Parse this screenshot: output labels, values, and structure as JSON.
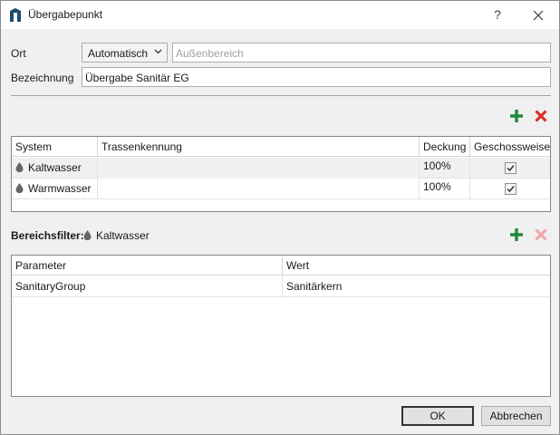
{
  "window": {
    "title": "Übergabepunkt",
    "help": "?"
  },
  "form": {
    "ort_label": "Ort",
    "ort_mode": "Automatisch",
    "ort_placeholder": "Außenbereich",
    "bezeichnung_label": "Bezeichnung",
    "bezeichnung_value": "Übergabe Sanitär EG"
  },
  "systems_grid": {
    "columns": [
      "System",
      "Trassenkennung",
      "Deckung",
      "Geschossweise"
    ],
    "rows": [
      {
        "system": "Kaltwasser",
        "trasse": "",
        "deckung": "100%",
        "geschossweise": true,
        "selected": true
      },
      {
        "system": "Warmwasser",
        "trasse": "",
        "deckung": "100%",
        "geschossweise": true,
        "selected": false
      }
    ]
  },
  "filter": {
    "label": "Bereichsfilter:",
    "system": "Kaltwasser",
    "columns": [
      "Parameter",
      "Wert"
    ],
    "rows": [
      {
        "parameter": "SanitaryGroup",
        "wert": "Sanitärkern"
      }
    ]
  },
  "buttons": {
    "ok": "OK",
    "cancel": "Abbrechen"
  },
  "colors": {
    "add": "#1f8a3a",
    "remove": "#d9342b",
    "remove_disabled": "#f0a8a8",
    "drop": "#666666"
  }
}
